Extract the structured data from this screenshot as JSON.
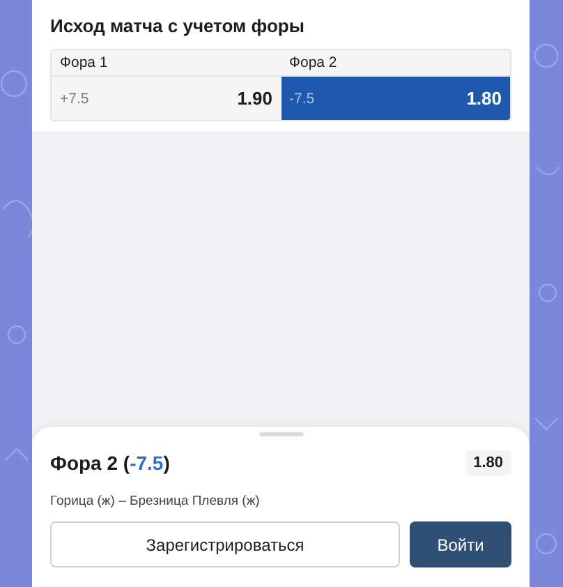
{
  "market": {
    "title": "Исход матча с учетом форы",
    "outcomes": [
      {
        "label": "Фора 1",
        "line": "+7.5",
        "odds": "1.90",
        "selected": false
      },
      {
        "label": "Фора 2",
        "line": "-7.5",
        "odds": "1.80",
        "selected": true
      }
    ]
  },
  "bet_slip": {
    "title": {
      "before": "Фора 2 (",
      "highlight": "-7.5",
      "after": ")"
    },
    "odds": "1.80",
    "match": "Горица (ж) – Брезница Плевля (ж)",
    "buttons": [
      {
        "label": "Зарегистрироваться",
        "kind": "secondary"
      },
      {
        "label": "Войти",
        "kind": "primary"
      }
    ]
  }
}
